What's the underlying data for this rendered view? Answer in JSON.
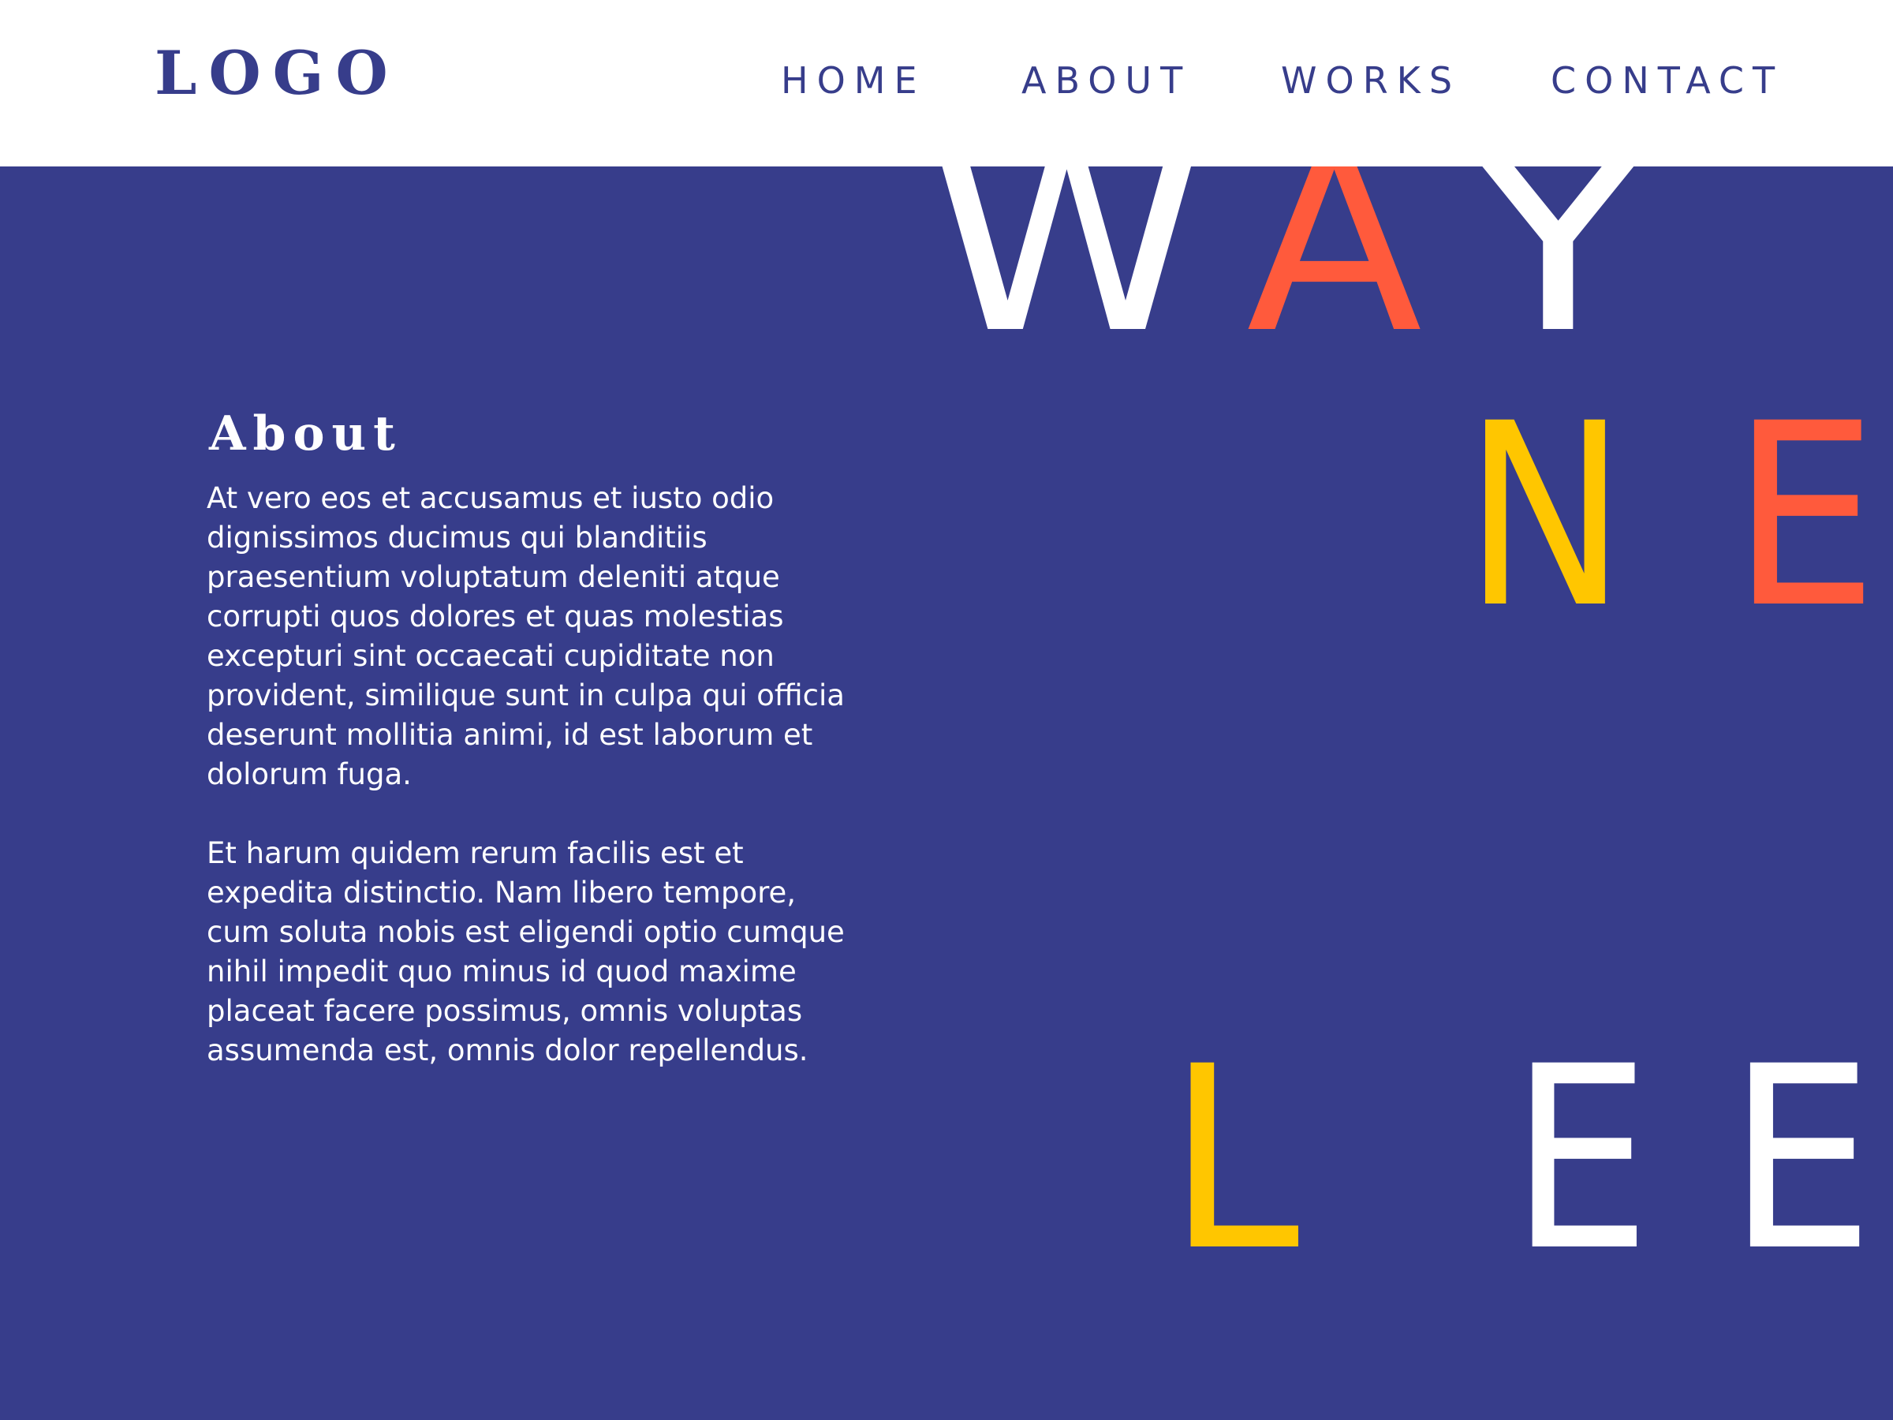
{
  "header": {
    "logo": "LOGO",
    "nav": {
      "home": "HOME",
      "about": "ABOUT",
      "works": "WORKS",
      "contact": "CONTACT"
    }
  },
  "hero": {
    "letters": [
      {
        "char": "W",
        "color": "#ffffff"
      },
      {
        "char": "A",
        "color": "#ff5a3c"
      },
      {
        "char": "Y",
        "color": "#ffffff"
      },
      {
        "char": "N",
        "color": "#ffc600"
      },
      {
        "char": "E",
        "color": "#ff5a3c"
      },
      {
        "char": "L",
        "color": "#ffc600"
      },
      {
        "char": "E",
        "color": "#ffffff"
      },
      {
        "char": "E",
        "color": "#ffffff"
      }
    ]
  },
  "about": {
    "title": "About",
    "paragraph_1": "At vero eos et accusamus et iusto odio dignissimos ducimus qui blanditiis praesentium voluptatum deleniti atque corrupti quos dolores et quas molestias excepturi sint occaecati cupiditate non provident, similique sunt in culpa qui officia deserunt mollitia animi, id est laborum et dolorum fuga.",
    "paragraph_2": "Et harum quidem rerum facilis est et expedita distinctio. Nam libero tempore, cum soluta nobis est eligendi optio cumque nihil impedit quo minus id quod maxime placeat facere possimus, omnis voluptas assumenda est, omnis dolor repellendus."
  },
  "colors": {
    "background": "#373d8b",
    "header_background": "#ffffff",
    "primary_text": "#373d8b",
    "accent_orange": "#ff5a3c",
    "accent_yellow": "#ffc600",
    "white": "#ffffff"
  }
}
